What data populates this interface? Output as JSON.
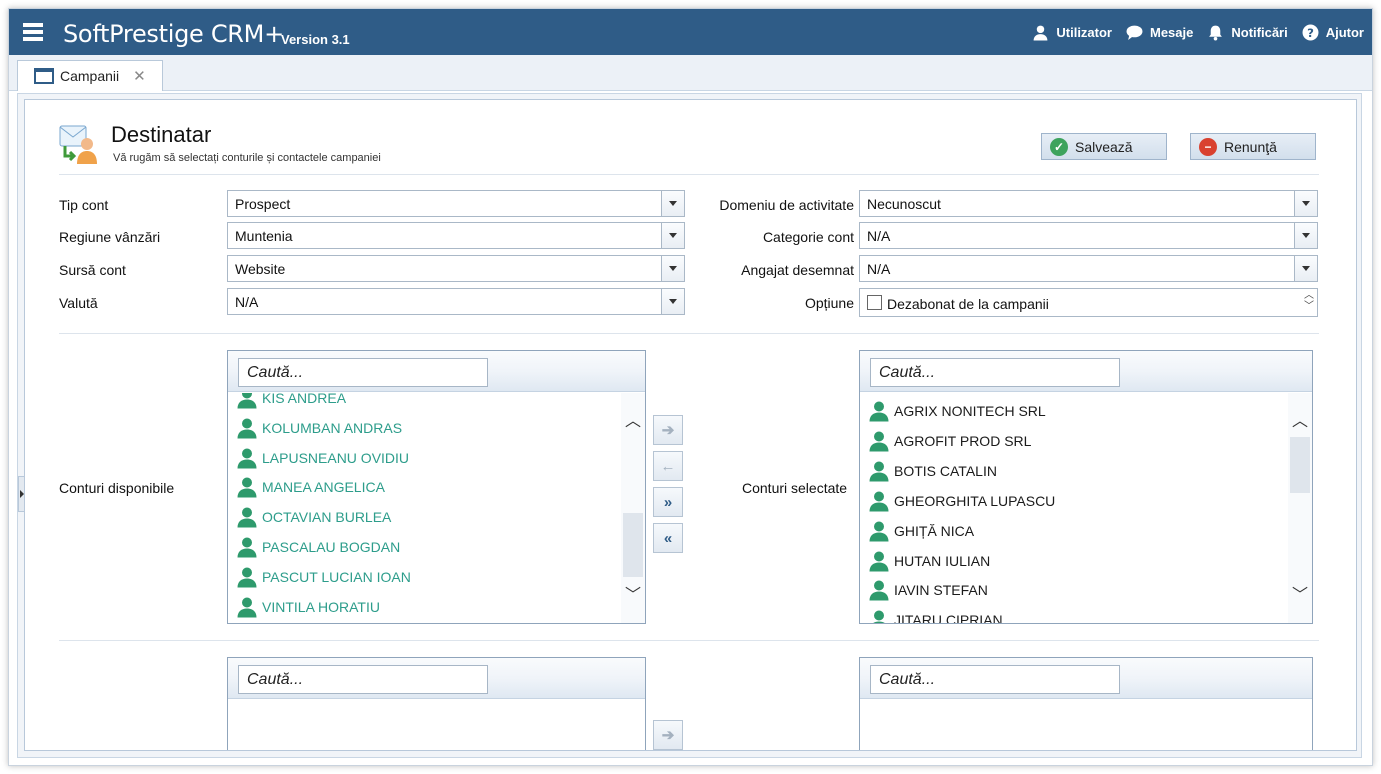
{
  "app": {
    "title": "SoftPrestige CRM+",
    "version": "Version 3.1"
  },
  "topnav": [
    {
      "label": "Utilizator",
      "icon": "user-icon"
    },
    {
      "label": "Mesaje",
      "icon": "chat-icon"
    },
    {
      "label": "Notificări",
      "icon": "bell-icon"
    },
    {
      "label": "Ajutor",
      "icon": "help-icon"
    }
  ],
  "tabs": [
    {
      "label": "Campanii",
      "icon": "window-icon",
      "close": "✕"
    }
  ],
  "header": {
    "title": "Destinatar",
    "subtitle": "Vă rugăm să selectați conturile și contactele campaniei",
    "save_label": "Salvează",
    "cancel_label": "Renunţă"
  },
  "form": {
    "left": [
      {
        "label": "Tip cont",
        "value": "Prospect"
      },
      {
        "label": "Regiune vânzări",
        "value": "Muntenia"
      },
      {
        "label": "Sursă cont",
        "value": "Website"
      },
      {
        "label": "Valută",
        "value": "N/A"
      }
    ],
    "right": [
      {
        "label": "Domeniu de activitate",
        "value": "Necunoscut"
      },
      {
        "label": "Categorie cont",
        "value": "N/A"
      },
      {
        "label": "Angajat desemnat",
        "value": "N/A"
      }
    ],
    "option_label": "Opțiune",
    "option_checkbox_label": "Dezabonat de la campanii",
    "option_checked": false
  },
  "accounts": {
    "available_label": "Conturi disponibile",
    "selected_label": "Conturi selectate",
    "search_placeholder": "Caută...",
    "available": [
      "KIS ANDREA",
      "KOLUMBAN ANDRAS",
      "LAPUSNEANU OVIDIU",
      "MANEA ANGELICA",
      "OCTAVIAN BURLEA",
      "PASCALAU BOGDAN",
      "PASCUT LUCIAN IOAN",
      "VINTILA HORATIU"
    ],
    "selected": [
      "AGRIX NONITECH SRL",
      "AGROFIT PROD SRL",
      "BOTIS CATALIN",
      "GHEORGHITA LUPASCU",
      "GHIȚĂ NICA",
      "HUTAN IULIAN",
      "IAVIN STEFAN",
      "JITARU CIPRIAN"
    ]
  },
  "contacts": {
    "search_placeholder": "Caută..."
  },
  "colors": {
    "topbar": "#2f5c87",
    "available_item": "#2d9d8b",
    "person_icon": "#2e9a6c"
  }
}
